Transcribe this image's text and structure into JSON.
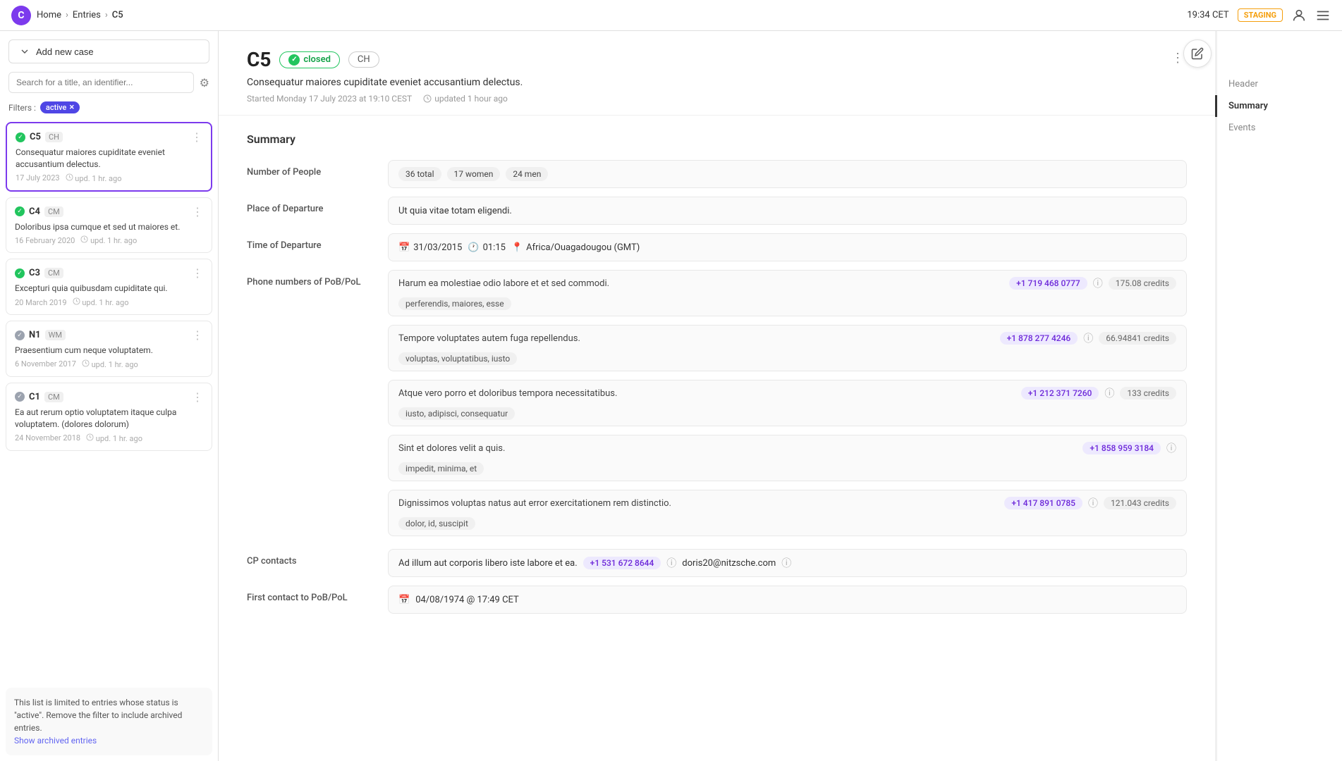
{
  "topbar": {
    "logo_letter": "C",
    "breadcrumb": [
      "Home",
      "Entries",
      "C5"
    ],
    "time": "19:34 CET",
    "staging_label": "STAGING",
    "account_icon": "account-icon",
    "menu_icon": "menu-icon"
  },
  "sidebar": {
    "add_btn_label": "Add new case",
    "search_placeholder": "Search for a title, an identifier...",
    "filters_label": "Filters :",
    "active_filter": "active",
    "items": [
      {
        "id": "C5",
        "tag": "CH",
        "status": "green",
        "title": "Consequatur maiores cupiditate eveniet accusantium delectus.",
        "date": "17 July 2023",
        "updated": "upd. 1 hr. ago",
        "active": true
      },
      {
        "id": "C4",
        "tag": "CM",
        "status": "green",
        "title": "Doloribus ipsa cumque et sed ut maiores et.",
        "date": "16 February 2020",
        "updated": "upd. 1 hr. ago",
        "active": false
      },
      {
        "id": "C3",
        "tag": "CM",
        "status": "green",
        "title": "Excepturi quia quibusdam cupiditate qui.",
        "date": "20 March 2019",
        "updated": "upd. 1 hr. ago",
        "active": false
      },
      {
        "id": "N1",
        "tag": "WM",
        "status": "gray",
        "title": "Praesentium cum neque voluptatem.",
        "date": "6 November 2017",
        "updated": "upd. 1 hr. ago",
        "active": false
      },
      {
        "id": "C1",
        "tag": "CM",
        "status": "gray",
        "title": "Ea aut rerum optio voluptatem itaque culpa voluptatem. (dolores dolorum)",
        "date": "24 November 2018",
        "updated": "upd. 1 hr. ago",
        "active": false
      }
    ],
    "notice": "This list is limited to entries whose status is \"active\". Remove the filter to include archived entries.",
    "show_archived_label": "Show archived entries"
  },
  "case": {
    "id": "C5",
    "status_label": "closed",
    "country": "CH",
    "description": "Consequatur maiores cupiditate eveniet accusantium delectus.",
    "started": "Started Monday 17 July 2023 at 19:10 CEST",
    "updated": "updated 1 hour ago",
    "summary_title": "Summary",
    "fields": {
      "number_of_people_label": "Number of People",
      "number_of_people_chips": [
        "36 total",
        "17 women",
        "24 men"
      ],
      "place_of_departure_label": "Place of Departure",
      "place_of_departure_value": "Ut quia vitae totam eligendi.",
      "time_of_departure_label": "Time of Departure",
      "time_of_departure_date": "31/03/2015",
      "time_of_departure_time": "01:15",
      "time_of_departure_zone": "Africa/Ouagadougou (GMT)",
      "phone_label": "Phone numbers of PoB/PoL",
      "phones": [
        {
          "text": "Harum ea molestiae odio labore et et sed commodi.",
          "number": "+1 719 468 0777",
          "credits": "175.08  credits",
          "tags": [
            "perferendis, maiores, esse"
          ]
        },
        {
          "text": "Tempore voluptates autem fuga repellendus.",
          "number": "+1 878 277 4246",
          "credits": "66.94841 credits",
          "tags": [
            "voluptas, voluptatibus, iusto"
          ]
        },
        {
          "text": "Atque vero porro et doloribus tempora necessitatibus.",
          "number": "+1 212 371 7260",
          "credits": "133  credits",
          "tags": [
            "iusto, adipisci, consequatur"
          ]
        },
        {
          "text": "Sint et dolores velit a quis.",
          "number": "+1 858 959 3184",
          "credits": "",
          "tags": [
            "impedit, minima, et"
          ]
        },
        {
          "text": "Dignissimos voluptas natus aut error exercitationem rem distinctio.",
          "number": "+1 417 891 0785",
          "credits": "121.043 credits",
          "tags": [
            "dolor, id, suscipit"
          ]
        }
      ],
      "cp_contacts_label": "CP contacts",
      "cp_contacts_text": "Ad illum aut corporis libero iste labore et ea.",
      "cp_contacts_phone": "+1 531 672 8644",
      "cp_contacts_email": "doris20@nitzsche.com",
      "first_contact_label": "First contact to PoB/PoL",
      "first_contact_value": "04/08/1974 @ 17:49 CET"
    }
  },
  "right_nav": {
    "items": [
      "Header",
      "Summary",
      "Events"
    ],
    "active_index": 1
  }
}
